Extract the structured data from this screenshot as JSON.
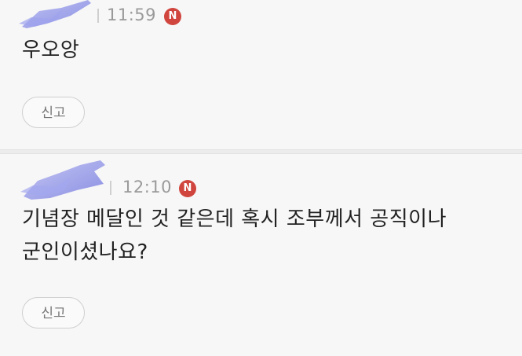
{
  "comments": [
    {
      "time": "11:59",
      "badge": "N",
      "text_lines": [
        "우오앙"
      ],
      "report_label": "신고"
    },
    {
      "time": "12:10",
      "badge": "N",
      "text_lines": [
        "기념장 메달인 것 같은데 혹시 조부께서 공직이나",
        "군인이셨나요?"
      ],
      "report_label": "신고"
    }
  ],
  "colors": {
    "badge": "#d0453d",
    "avatar_blur": "#8a8ee6",
    "text": "#222222",
    "meta": "#9a9a9a"
  },
  "icons": {
    "new_badge": "new-badge-icon",
    "avatar": "blurred-avatar-icon"
  }
}
